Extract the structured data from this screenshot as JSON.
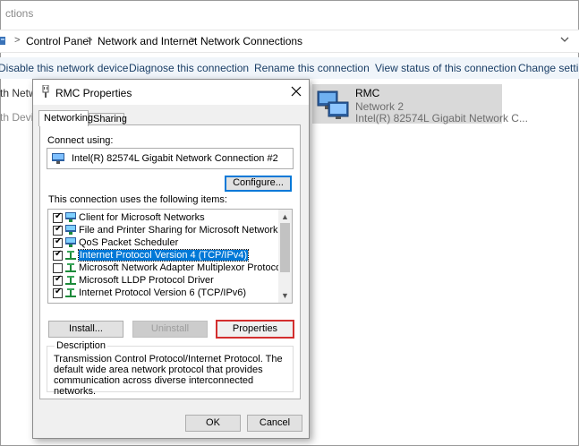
{
  "window": {
    "title_fragment": "ctions",
    "breadcrumb": [
      "Control Panel",
      "Network and Internet",
      "Network Connections"
    ]
  },
  "commands": [
    "Disable this network device",
    "Diagnose this connection",
    "Rename this connection",
    "View status of this connection",
    "Change settings"
  ],
  "left_list": {
    "row1": "th Netw",
    "row2": "th Devic"
  },
  "connection_item": {
    "name": "RMC",
    "network": "Network 2",
    "adapter": "Intel(R) 82574L Gigabit Network C..."
  },
  "dialog": {
    "title": "RMC Properties",
    "tabs": [
      "Networking",
      "Sharing"
    ],
    "connect_using_label": "Connect using:",
    "adapter_name": "Intel(R) 82574L Gigabit Network Connection #2",
    "configure_button": "Configure...",
    "items_label": "This connection uses the following items:",
    "items": [
      {
        "label": "Client for Microsoft Networks",
        "checked": true,
        "icon": "network-client-icon"
      },
      {
        "label": "File and Printer Sharing for Microsoft Networks",
        "checked": true,
        "icon": "network-service-icon"
      },
      {
        "label": "QoS Packet Scheduler",
        "checked": true,
        "icon": "network-service-icon"
      },
      {
        "label": "Internet Protocol Version 4 (TCP/IPv4)",
        "checked": true,
        "icon": "protocol-icon",
        "selected": true
      },
      {
        "label": "Microsoft Network Adapter Multiplexor Protocol",
        "checked": false,
        "icon": "protocol-icon"
      },
      {
        "label": "Microsoft LLDP Protocol Driver",
        "checked": true,
        "icon": "protocol-icon"
      },
      {
        "label": "Internet Protocol Version 6 (TCP/IPv6)",
        "checked": true,
        "icon": "protocol-icon"
      }
    ],
    "install_button": "Install...",
    "uninstall_button": "Uninstall",
    "properties_button": "Properties",
    "description_label": "Description",
    "description_text": "Transmission Control Protocol/Internet Protocol. The default wide area network protocol that provides communication across diverse interconnected networks.",
    "ok_button": "OK",
    "cancel_button": "Cancel"
  },
  "colors": {
    "selection": "#0078d7",
    "highlight_border": "#d32f2f",
    "command_text": "#1a3e66"
  }
}
